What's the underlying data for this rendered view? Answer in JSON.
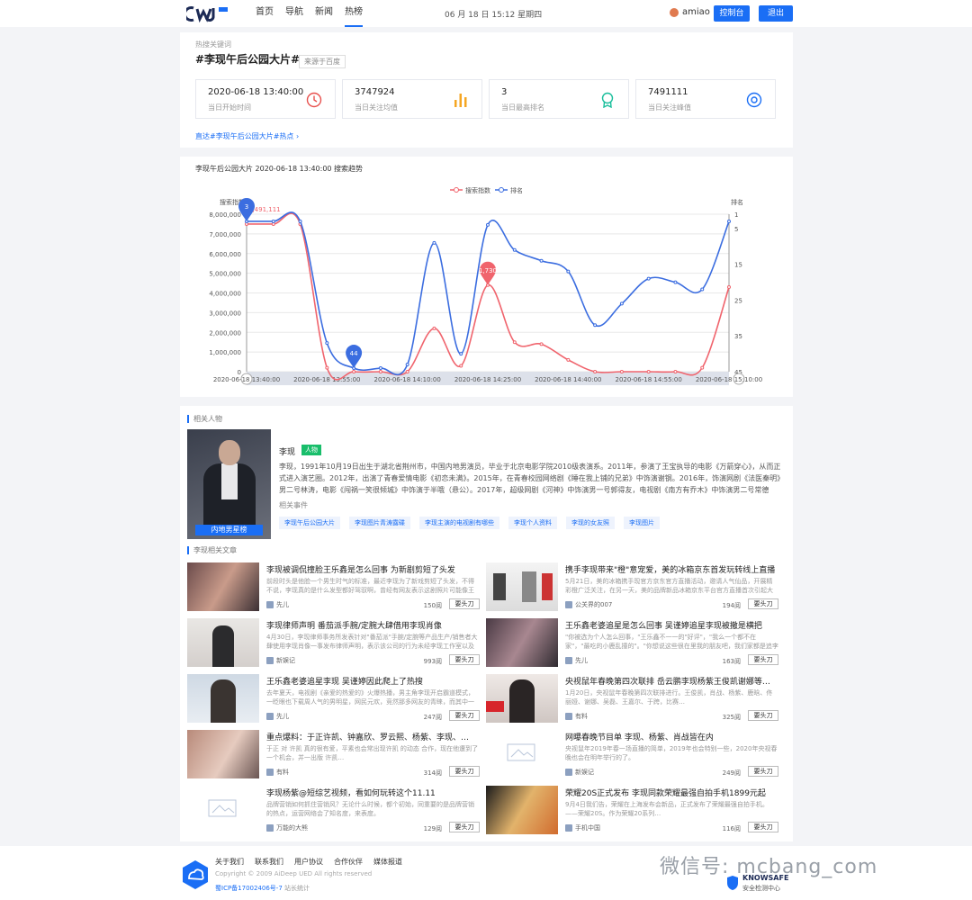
{
  "nav": {
    "items": [
      {
        "label": "首页"
      },
      {
        "label": "导航"
      },
      {
        "label": "新闻"
      },
      {
        "label": "热榜"
      }
    ],
    "date": "06 月 18 日 15:12 星期四",
    "user": "amiao",
    "console_btn": "控制台",
    "logout_btn": "退出"
  },
  "hotkey": {
    "label": "热搜关键词",
    "title": "#李现午后公园大片#",
    "source": "来源于百度",
    "stats": [
      {
        "value": "2020-06-18 13:40:00",
        "label": "当日开始时间",
        "icon": "clock-icon",
        "color": "#e8504d"
      },
      {
        "value": "3747924",
        "label": "当日关注均值",
        "icon": "bar-chart-icon",
        "color": "#f5a623"
      },
      {
        "value": "3",
        "label": "当日最高排名",
        "icon": "medal-icon",
        "color": "#19be9b"
      },
      {
        "value": "7491111",
        "label": "当日关注峰值",
        "icon": "eye-icon",
        "color": "#1a6ef5"
      }
    ],
    "link": "直达#李现午后公园大片#热点 ›"
  },
  "trend": {
    "title": "李现午后公园大片 2020-06-18 13:40:00 搜索趋势"
  },
  "chart_data": {
    "type": "line",
    "x": [
      "13:40",
      "13:45",
      "13:50",
      "13:55",
      "14:00",
      "14:05",
      "14:10",
      "14:15",
      "14:20",
      "14:25",
      "14:30",
      "14:35",
      "14:40",
      "14:45",
      "14:50",
      "14:55",
      "15:00",
      "15:05",
      "15:10"
    ],
    "xticks": [
      "2020-06-18 13:40:00",
      "2020-06-18 13:55:00",
      "2020-06-18 14:10:00",
      "2020-06-18 14:25:00",
      "2020-06-18 14:40:00",
      "2020-06-18 14:55:00",
      "2020-06-18 15:10:00"
    ],
    "xtick_idx": [
      0,
      3,
      6,
      9,
      12,
      15,
      18
    ],
    "series": [
      {
        "name": "搜索指数",
        "axis": "left",
        "color": "#f0646d",
        "values": [
          7500000,
          7500000,
          7500000,
          200000,
          0,
          0,
          0,
          2200000,
          300000,
          4400000,
          1500000,
          1400000,
          600000,
          0,
          0,
          0,
          0,
          200000,
          4300000
        ]
      },
      {
        "name": "排名",
        "axis": "right",
        "color": "#3b6de0",
        "values": [
          3,
          3,
          3,
          37,
          44,
          44,
          43,
          9,
          40,
          4,
          11,
          14,
          17,
          32,
          26,
          19,
          20,
          22,
          3
        ]
      }
    ],
    "ylabel_left": "搜索指数",
    "ylim_left": [
      0,
      8000000
    ],
    "yticks_left": [
      "0",
      "1,000,000",
      "2,000,000",
      "3,000,000",
      "4,000,000",
      "5,000,000",
      "6,000,000",
      "7,000,000",
      "8,000,000"
    ],
    "ylabel_right": "排名",
    "ylim_right": [
      1,
      45
    ],
    "yticks_right": [
      "1",
      "5",
      "15",
      "25",
      "35",
      "45"
    ],
    "markers": [
      {
        "series": 1,
        "idx": 0,
        "label": "3"
      },
      {
        "series": 1,
        "idx": 4,
        "label": "44"
      },
      {
        "series": 0,
        "idx": 9,
        "label": "1,730"
      }
    ],
    "top_label": "7,491,111",
    "legend": "top-center",
    "grid": true
  },
  "person": {
    "section": "相关人物",
    "name": "李现",
    "badge": "人物",
    "bio": "李现，1991年10月19日出生于湖北省荆州市，中国内地男演员，毕业于北京电影学院2010级表演系。2011年，参演了王宝执导的电影《万箭穿心》，从而正式进入演艺圈。2012年，出演了青春爱情电影《初恋未满》。2015年，在青春校园网络剧《睡在我上铺的兄弟》中饰演谢钢。2016年，饰演网剧《法医秦明》男二号林涛，电影《闯祸一笑很倾城》中饰演于半哦（悬公）。2017年，超级网剧《河神》中饰演男一号郭得友，电视剧《南方有乔木》中饰演男二号常德瑞，…",
    "photo_tag": "内地男星榜",
    "related": "相关事件",
    "events": [
      "李现午后公园大片",
      "李现图片青涛露碟",
      "李现主演的电视剧有哪些",
      "李现个人资料",
      "李现的女友照",
      "李现图片"
    ]
  },
  "articles": {
    "section": "李现相关文章",
    "btn": "要头刀",
    "left": [
      {
        "title": "李现被调侃撞脸王乐鑫是怎么回事 为新剧剪短了头发",
        "snippet": "前段时头是他脸一个男生时气的标准，最近李现为了新戏剪短了头发，不得不说，李现真的是什么发型都好驾驭啊，曾经有网友表示这剧照片可能像王乐鑫…",
        "author": "先儿",
        "reads": "150阅"
      },
      {
        "title": "李现律师声明 番茄派手腕/定腕大肆借用李现肖像",
        "snippet": "4月30日，李现律师事务所发表针对\"番茄派\"手腕/定腕等产品生产/销售者大肆使用李现肖像一事发布律师声明，表示该公司的行为未经李现工作室以及李现…",
        "author": "新娱记",
        "reads": "993阅"
      },
      {
        "title": "王乐鑫老婆追星李现 吴谨婷因此爬上了热搜",
        "snippet": "去年夏天，电视剧《亲爱的热爱的》火爆热播，男主角李现开启霸道模式，一眨眼也下载周人气的男明星，网民元欢，竞然那多网友的青睐，而其中一位…",
        "author": "先儿",
        "reads": "247阅"
      },
      {
        "title": "重点爆料：于正许凯、钟嘉欣、罗云熙、杨紫、李现、…",
        "snippet": "于正 对 许凯 真的很有爱，平素也会常出现许凯 的动态 合作，现在他遭到了一个机会，并一出版 许凯…",
        "author": "有料",
        "reads": "314阅"
      },
      {
        "title": "李现杨紫@短综艺视频，看如何玩转这个11.11",
        "snippet": "品牌营销如何抓住营销风？无论什么时候，都个初始，同重要的是品牌营销的热点，运营网络会了知名度，来表度。",
        "author": "万能的大熊",
        "reads": "129阅"
      }
    ],
    "right": [
      {
        "title": "携手李现带来\"橙\"意宠爱，美的冰箱京东首发玩转线上直播",
        "snippet": "5月21日，美的冰箱携手现官方京东官方直播活动，邀请人气仙品，开展精彩橙广泛关注，在另一天，美的品牌新品冰箱京东平台官方直播首次引起大关注，再图下…",
        "author": "公关界的007",
        "reads": "194阅"
      },
      {
        "title": "王乐鑫老婆追星是怎么回事 吴谨婷追星李现被撒是横把",
        "snippet": "\"你被选为个人怎么回事，\"王乐鑫不一一的\"好评\"，\"我么一个都不在家\"，\"最吃的小鹿乱撞的\"。\"你想说这些很在里我的朋友吧，我们家都是追李了\"，说话…",
        "author": "先儿",
        "reads": "163阅"
      },
      {
        "title": "央视鼠年春晚第四次联排 岳云鹏李现杨紫王俊凯谢娜等…",
        "snippet": "1月20日，央视鼠年春晚第四次联排进行。王俊凯，肖战、杨紫、鹿晗、佟丽娅、谢娜、吴磊、王嘉尔、于跨，比赛…",
        "author": "有料",
        "reads": "325阅"
      },
      {
        "title": "网曝春晚节目单 李现、杨紫、肖战皆在内",
        "snippet": "央视鼠年2019年春一场直播的简单，2019年也会特别一些，2020年央视春晚也会在明年举行的了。",
        "author": "新娱记",
        "reads": "249阅"
      },
      {
        "title": "荣耀20S正式发布 李现同款荣耀最强自拍手机1899元起",
        "snippet": "9月4日我们告，荣耀在上海发布会新品，正式发布了荣耀最强自拍手机。——荣耀20S。作为荣耀20系列…",
        "author": "手机中国",
        "reads": "116阅"
      }
    ]
  },
  "footer": {
    "links": [
      "关于我们",
      "联系我们",
      "用户协议",
      "合作伙伴",
      "媒体报道"
    ],
    "copyright": "Copyright © 2009 AiDeep UED All rights reserved",
    "icp": "蜀ICP备17002406号-7",
    "stats": "站长统计",
    "wechat": "微信号: mcbang_com",
    "knowsafe": "KNOWSAFE",
    "knowsafe_sub": "安全检测中心"
  }
}
